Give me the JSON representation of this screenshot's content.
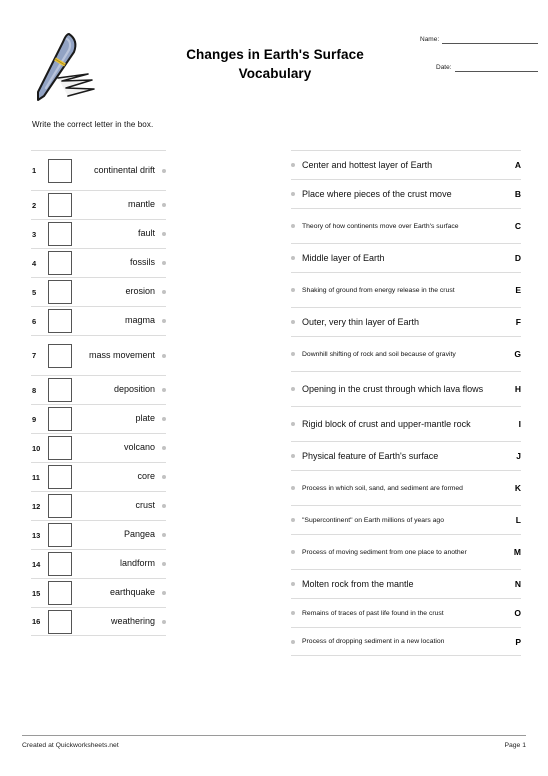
{
  "header": {
    "title_line1": "Changes in Earth's Surface",
    "title_line2": "Vocabulary",
    "name_label": "Name:",
    "date_label": "Date:",
    "pen_icon": "fountain-pen-writing-icon"
  },
  "instruction": "Write the correct letter in the box.",
  "terms": [
    {
      "number": "1",
      "label": "continental drift",
      "answer": ""
    },
    {
      "number": "2",
      "label": "mantle",
      "answer": ""
    },
    {
      "number": "3",
      "label": "fault",
      "answer": ""
    },
    {
      "number": "4",
      "label": "fossils",
      "answer": ""
    },
    {
      "number": "5",
      "label": "erosion",
      "answer": ""
    },
    {
      "number": "6",
      "label": "magma",
      "answer": ""
    },
    {
      "number": "7",
      "label": "mass movement",
      "answer": ""
    },
    {
      "number": "8",
      "label": "deposition",
      "answer": ""
    },
    {
      "number": "9",
      "label": "plate",
      "answer": ""
    },
    {
      "number": "10",
      "label": "volcano",
      "answer": ""
    },
    {
      "number": "11",
      "label": "core",
      "answer": ""
    },
    {
      "number": "12",
      "label": "crust",
      "answer": ""
    },
    {
      "number": "13",
      "label": "Pangea",
      "answer": ""
    },
    {
      "number": "14",
      "label": "landform",
      "answer": ""
    },
    {
      "number": "15",
      "label": "earthquake",
      "answer": ""
    },
    {
      "number": "16",
      "label": "weathering",
      "answer": ""
    }
  ],
  "definitions": [
    {
      "letter": "A",
      "text": "Center and hottest layer of Earth",
      "size": "big"
    },
    {
      "letter": "B",
      "text": "Place where pieces of the crust move",
      "size": "big"
    },
    {
      "letter": "C",
      "text": "Theory of how continents move over Earth's surface",
      "size": "small"
    },
    {
      "letter": "D",
      "text": "Middle layer of Earth",
      "size": "big"
    },
    {
      "letter": "E",
      "text": "Shaking of ground from energy release in the crust",
      "size": "small"
    },
    {
      "letter": "F",
      "text": "Outer, very thin layer of Earth",
      "size": "big"
    },
    {
      "letter": "G",
      "text": "Downhill shifting of rock and soil because of gravity",
      "size": "small"
    },
    {
      "letter": "H",
      "text": "Opening in the crust through which lava flows",
      "size": "big"
    },
    {
      "letter": "I",
      "text": "Rigid block of crust and upper-mantle rock",
      "size": "big"
    },
    {
      "letter": "J",
      "text": "Physical feature of Earth's surface",
      "size": "big"
    },
    {
      "letter": "K",
      "text": "Process in which soil, sand, and sediment are formed",
      "size": "small"
    },
    {
      "letter": "L",
      "text": "\"Supercontinent\" on Earth millions of years ago",
      "size": "small"
    },
    {
      "letter": "M",
      "text": "Process of moving sediment from one place to another",
      "size": "small"
    },
    {
      "letter": "N",
      "text": "Molten rock from the mantle",
      "size": "big"
    },
    {
      "letter": "O",
      "text": "Remains of traces of past life found in the crust",
      "size": "small"
    },
    {
      "letter": "P",
      "text": "Process of dropping sediment in a new location",
      "size": "small"
    }
  ],
  "footer": {
    "credit": "Created at Quickworksheets.net",
    "page": "Page 1"
  },
  "colors": {
    "pen_body": "#92a3c4",
    "pen_outline": "#1a1a1a",
    "pen_band": "#e8c43a",
    "rule": "#dcdcdc",
    "dot": "#c2c2c2"
  }
}
